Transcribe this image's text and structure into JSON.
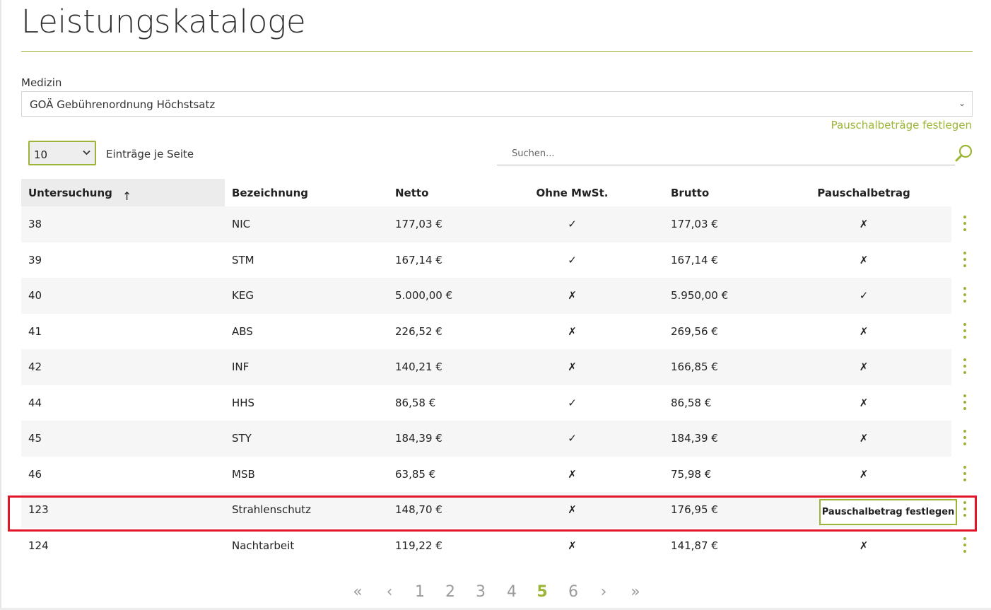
{
  "page": {
    "title": "Leistungskataloge"
  },
  "catalog_filter": {
    "label": "Medizin",
    "selected": "GOÄ Gebührenordnung Höchstsatz"
  },
  "pauschal_link": "Pauschalbeträge festlegen",
  "page_size": {
    "value": "10",
    "label": "Einträge je Seite"
  },
  "search": {
    "placeholder": "Suchen...",
    "value": ""
  },
  "table": {
    "columns": [
      "Untersuchung",
      "Bezeichnung",
      "Netto",
      "Ohne MwSt.",
      "Brutto",
      "Pauschalbetrag"
    ],
    "sort_arrow": "↑",
    "rows": [
      {
        "untersuchung": "38",
        "bezeichnung": "NIC",
        "netto": "177,03 €",
        "ohne_mwst": "✓",
        "brutto": "177,03 €",
        "pauschal": "✗"
      },
      {
        "untersuchung": "39",
        "bezeichnung": "STM",
        "netto": "167,14 €",
        "ohne_mwst": "✓",
        "brutto": "167,14 €",
        "pauschal": "✗"
      },
      {
        "untersuchung": "40",
        "bezeichnung": "KEG",
        "netto": "5.000,00 €",
        "ohne_mwst": "✗",
        "brutto": "5.950,00 €",
        "pauschal": "✓"
      },
      {
        "untersuchung": "41",
        "bezeichnung": "ABS",
        "netto": "226,52 €",
        "ohne_mwst": "✗",
        "brutto": "269,56 €",
        "pauschal": "✗"
      },
      {
        "untersuchung": "42",
        "bezeichnung": "INF",
        "netto": "140,21 €",
        "ohne_mwst": "✗",
        "brutto": "166,85 €",
        "pauschal": "✗"
      },
      {
        "untersuchung": "44",
        "bezeichnung": "HHS",
        "netto": "86,58 €",
        "ohne_mwst": "✓",
        "brutto": "86,58 €",
        "pauschal": "✗"
      },
      {
        "untersuchung": "45",
        "bezeichnung": "STY",
        "netto": "184,39 €",
        "ohne_mwst": "✓",
        "brutto": "184,39 €",
        "pauschal": "✗"
      },
      {
        "untersuchung": "46",
        "bezeichnung": "MSB",
        "netto": "63,85 €",
        "ohne_mwst": "✗",
        "brutto": "75,98 €",
        "pauschal": "✗"
      },
      {
        "untersuchung": "123",
        "bezeichnung": "Strahlenschutz",
        "netto": "148,70 €",
        "ohne_mwst": "✗",
        "brutto": "176,95 €",
        "pauschal": ""
      },
      {
        "untersuchung": "124",
        "bezeichnung": "Nachtarbeit",
        "netto": "119,22 €",
        "ohne_mwst": "✗",
        "brutto": "141,87 €",
        "pauschal": "✗"
      }
    ]
  },
  "row_action_button": "Pauschalbetrag festlegen",
  "pagination": {
    "first": "«",
    "prev": "‹",
    "pages": [
      "1",
      "2",
      "3",
      "4",
      "5",
      "6"
    ],
    "current": "5",
    "next": "›",
    "last": "»"
  },
  "colors": {
    "accent": "#9bb536",
    "highlight": "#e0162b",
    "row_stripe": "#f6f6f6"
  }
}
